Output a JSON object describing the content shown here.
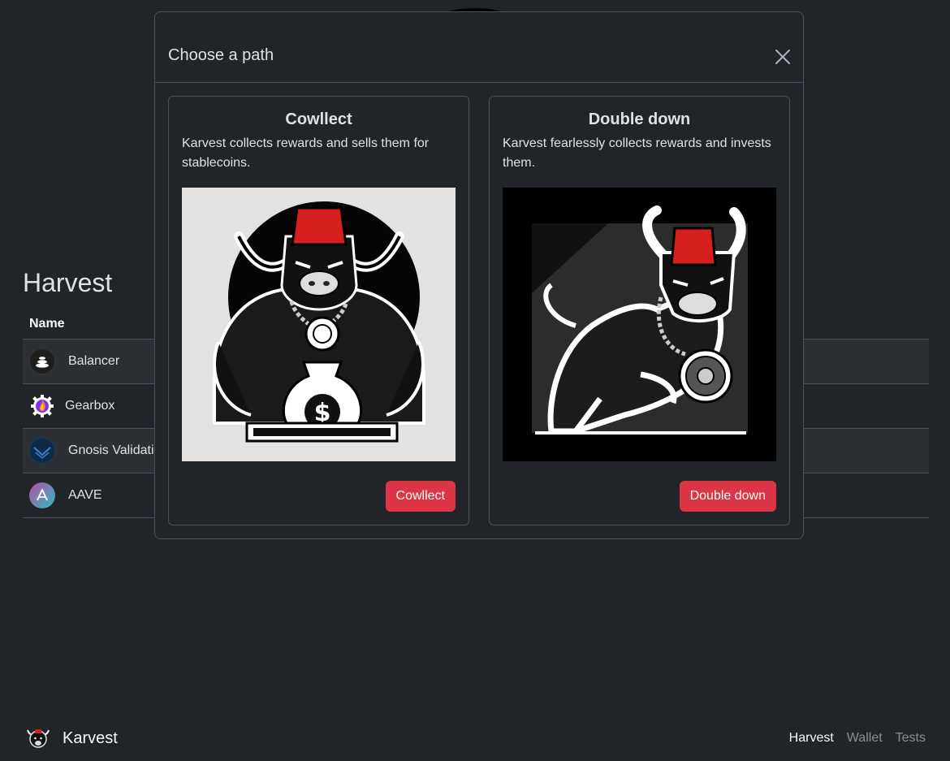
{
  "app": {
    "brand": "Karvest"
  },
  "page": {
    "title": "Harvest",
    "table": {
      "header_name": "Name",
      "rows": [
        {
          "name": "Balancer",
          "icon": "balancer-icon"
        },
        {
          "name": "Gearbox",
          "icon": "gearbox-icon"
        },
        {
          "name": "Gnosis Validati",
          "icon": "gnosis-icon"
        },
        {
          "name": "AAVE",
          "icon": "aave-icon"
        }
      ]
    }
  },
  "nav": {
    "items": [
      "Harvest",
      "Wallet",
      "Tests"
    ],
    "active": "Harvest"
  },
  "modal": {
    "title": "Choose a path",
    "close_icon": "close-icon",
    "options": [
      {
        "title": "Cowllect",
        "description": "Karvest collects rewards and sells them for stablecoins.",
        "button": "Cowllect",
        "image": "bull-with-money-bag-illustration"
      },
      {
        "title": "Double down",
        "description": "Karvest fearlessly collects rewards and invests them.",
        "button": "Double down",
        "image": "charging-bull-illustration"
      }
    ]
  },
  "colors": {
    "background": "#212529",
    "border": "#495057",
    "danger": "#dc3545",
    "fez_red": "#d62020"
  }
}
